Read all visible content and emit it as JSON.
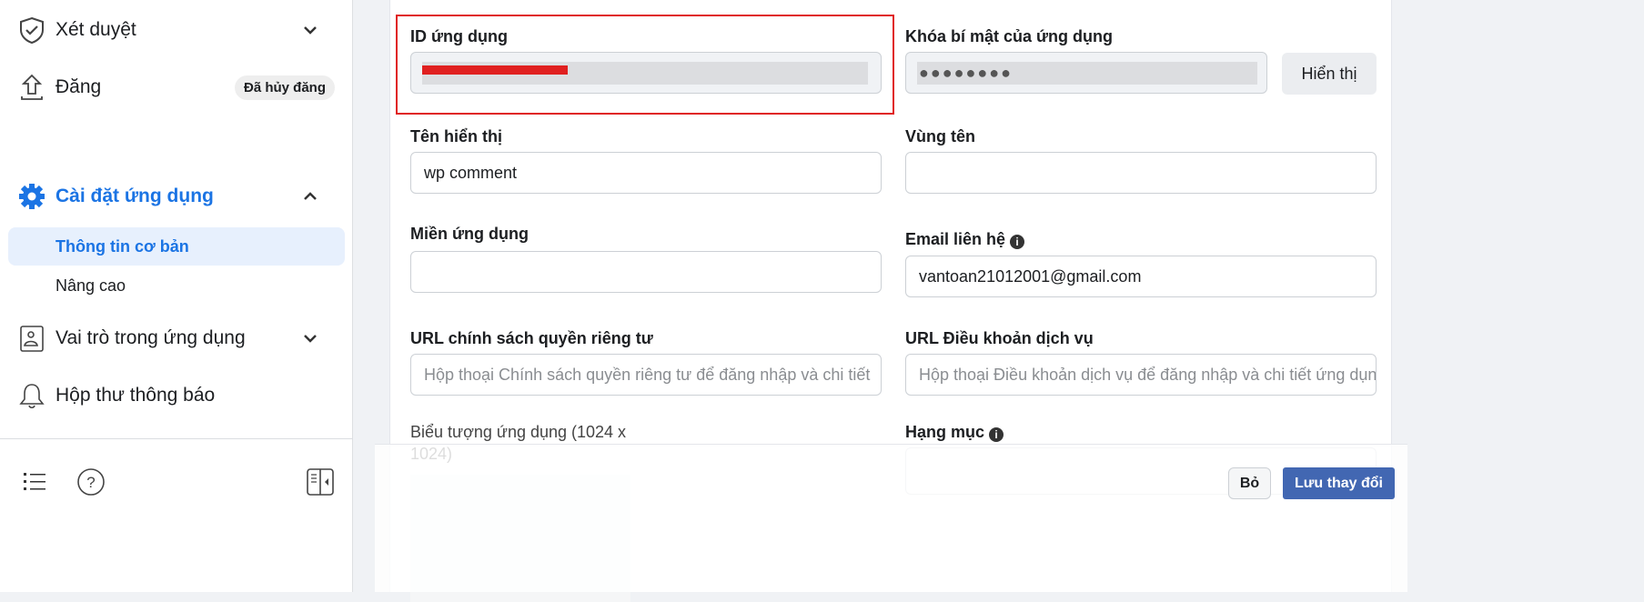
{
  "sidebar": {
    "items": [
      {
        "label": "Xét duyệt",
        "icon": "shield-check-icon"
      },
      {
        "label": "Đăng",
        "icon": "upload-icon",
        "badge": "Đã hủy đăng"
      },
      {
        "label": "Cài đặt ứng dụng",
        "icon": "gear-icon",
        "active": true
      },
      {
        "label": "Vai trò trong ứng dụng",
        "icon": "id-card-icon"
      },
      {
        "label": "Hộp thư thông báo",
        "icon": "bell-icon"
      }
    ],
    "subitems": [
      {
        "label": "Thông tin cơ bản",
        "active": true
      },
      {
        "label": "Nâng cao"
      }
    ]
  },
  "form": {
    "app_id": {
      "label": "ID ứng dụng",
      "value": "redacted"
    },
    "app_secret": {
      "label": "Khóa bí mật của ứng dụng",
      "value": "●●●●●●●●",
      "show_label": "Hiển thị"
    },
    "display_name": {
      "label": "Tên hiển thị",
      "value": "wp comment"
    },
    "namespace": {
      "label": "Vùng tên",
      "value": ""
    },
    "app_domains": {
      "label": "Miền ứng dụng",
      "value": ""
    },
    "contact_email": {
      "label": "Email liên hệ",
      "value": "vantoan21012001@gmail.com"
    },
    "privacy_url": {
      "label": "URL chính sách quyền riêng tư",
      "placeholder": "Hộp thoại Chính sách quyền riêng tư để đăng nhập và chi tiết"
    },
    "tos_url": {
      "label": "URL Điều khoản dịch vụ",
      "placeholder": "Hộp thoại Điều khoản dịch vụ để đăng nhập và chi tiết ứng dụng"
    },
    "app_icon": {
      "label": "Biểu tượng ứng dụng (1024 x 1024)"
    },
    "category": {
      "label": "Hạng mục"
    }
  },
  "footer": {
    "discard_label": "Bỏ",
    "save_label": "Lưu thay đổi"
  },
  "colors": {
    "accent": "#1b74e4",
    "save_button": "#4267b2",
    "highlight_box": "#e02020"
  }
}
